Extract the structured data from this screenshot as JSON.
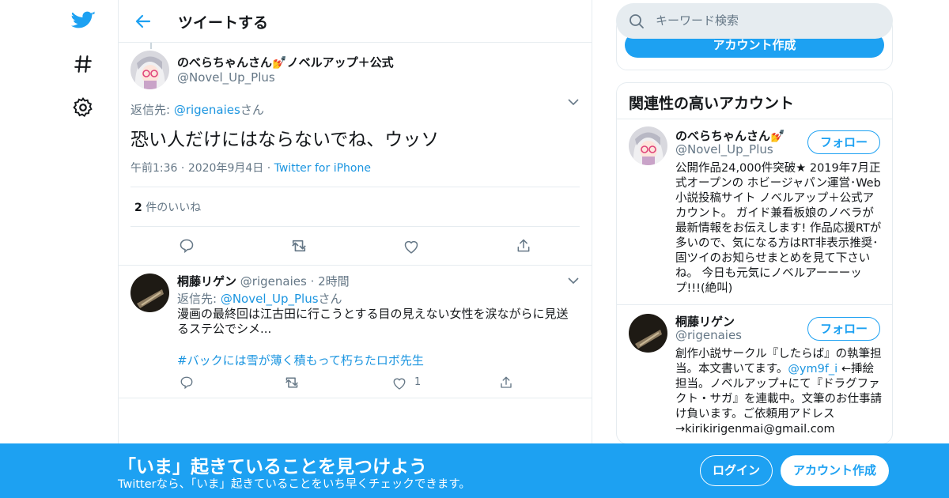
{
  "nav": {
    "icons": [
      "twitter-logo",
      "hash-icon",
      "gear-icon"
    ]
  },
  "header": {
    "title": "ツイートする"
  },
  "main_tweet": {
    "display_name": "のべらちゃんさん💅ノベルアップ＋公式",
    "screen_name": "@Novel_Up_Plus",
    "reply_to_prefix": "返信先: ",
    "reply_to_handle": "@rigenaies",
    "reply_to_suffix": "さん",
    "text": "恐い人だけにはならないでね、ウッソ",
    "time": "午前1:36",
    "date": "2020年9月4日",
    "sep": "·",
    "source": "Twitter for iPhone",
    "likes_count": "2",
    "likes_label": " 件のいいね"
  },
  "reply_tweet": {
    "display_name": "桐藤リゲン",
    "screen_name": "@rigenaies",
    "sep": "·",
    "time": "2時間",
    "reply_to_prefix": "返信先: ",
    "reply_to_handle": "@Novel_Up_Plus",
    "reply_to_suffix": "さん",
    "text": "漫画の最終回は江古田に行こうとする目の見えない女性を涙ながらに見送るステ公でシメ...",
    "hashtag": "#バックには雪が薄く積もって朽ちたロボ先生",
    "like_count": "1"
  },
  "search": {
    "placeholder": "キーワード検索"
  },
  "top_card": {
    "create_account_label": "アカウント作成"
  },
  "related": {
    "title": "関連性の高いアカウント",
    "accounts": [
      {
        "display_name": "のべらちゃんさん💅",
        "screen_name": "@Novel_Up_Plus",
        "follow_label": "フォロー",
        "bio": "公開作品24,000件突破★ 2019年7月正式オープンの ホビージャパン運営･Web小説投稿サイト ノベルアップ＋公式アカウント。 ガイド兼看板娘のノベラが最新情報をお伝えします! 作品応援RTが多いので、気になる方はRT非表示推奨･固ツイのお知らせまとめを見て下さいね。 今日も元気にノベルアーーーップ!!!(絶叫)"
      },
      {
        "display_name": "桐藤リゲン",
        "screen_name": "@rigenaies",
        "follow_label": "フォロー",
        "bio_part1": "創作小説サークル『したらば』の執筆担当。本文書いてます。",
        "bio_link": "@ym9f_i",
        "bio_part2": " ←挿絵担当。ノベルアップ+にて『ドラグファクト・サガ』を連載中。文筆のお仕事請け負います。ご依頼用アドレス→kirikirigenmai@gmail.com"
      }
    ]
  },
  "bottom_bar": {
    "title": "「いま」起きていることを見つけよう",
    "subtitle": "Twitterなら、「いま」起きていることをいち早くチェックできます。",
    "login_label": "ログイン",
    "signup_label": "アカウント作成"
  },
  "colors": {
    "accent": "#1da1f2",
    "link": "#1b95e0",
    "muted": "#657786",
    "border": "#e6ecf0"
  }
}
